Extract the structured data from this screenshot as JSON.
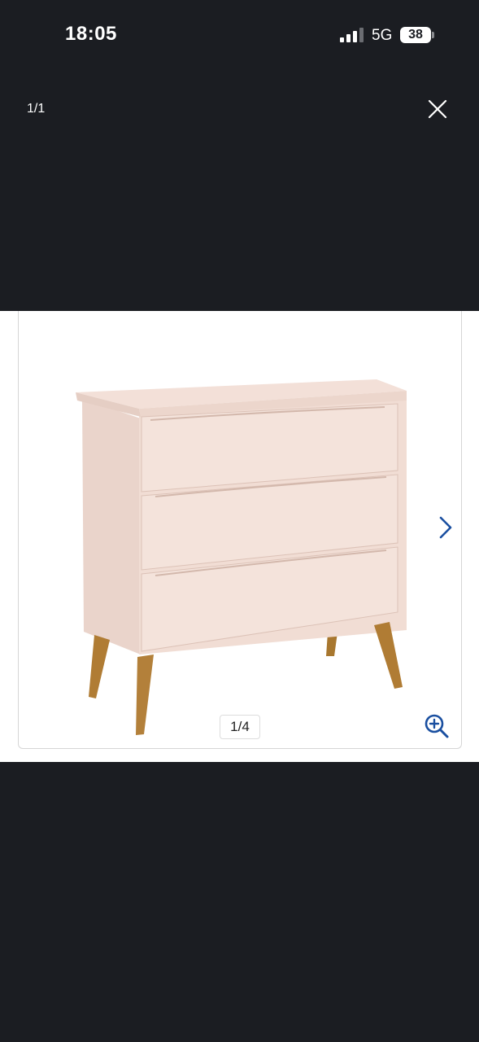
{
  "status_bar": {
    "time": "18:05",
    "network": "5G",
    "battery": "38"
  },
  "viewer": {
    "counter": "1/1",
    "close_icon": "close-icon"
  },
  "gallery": {
    "page_indicator": "1/4",
    "next_icon": "chevron-right-icon",
    "zoom_icon": "zoom-in-icon",
    "accent_color": "#1a4fa0"
  },
  "colors": {
    "background": "#1b1d22",
    "panel": "#ffffff"
  }
}
